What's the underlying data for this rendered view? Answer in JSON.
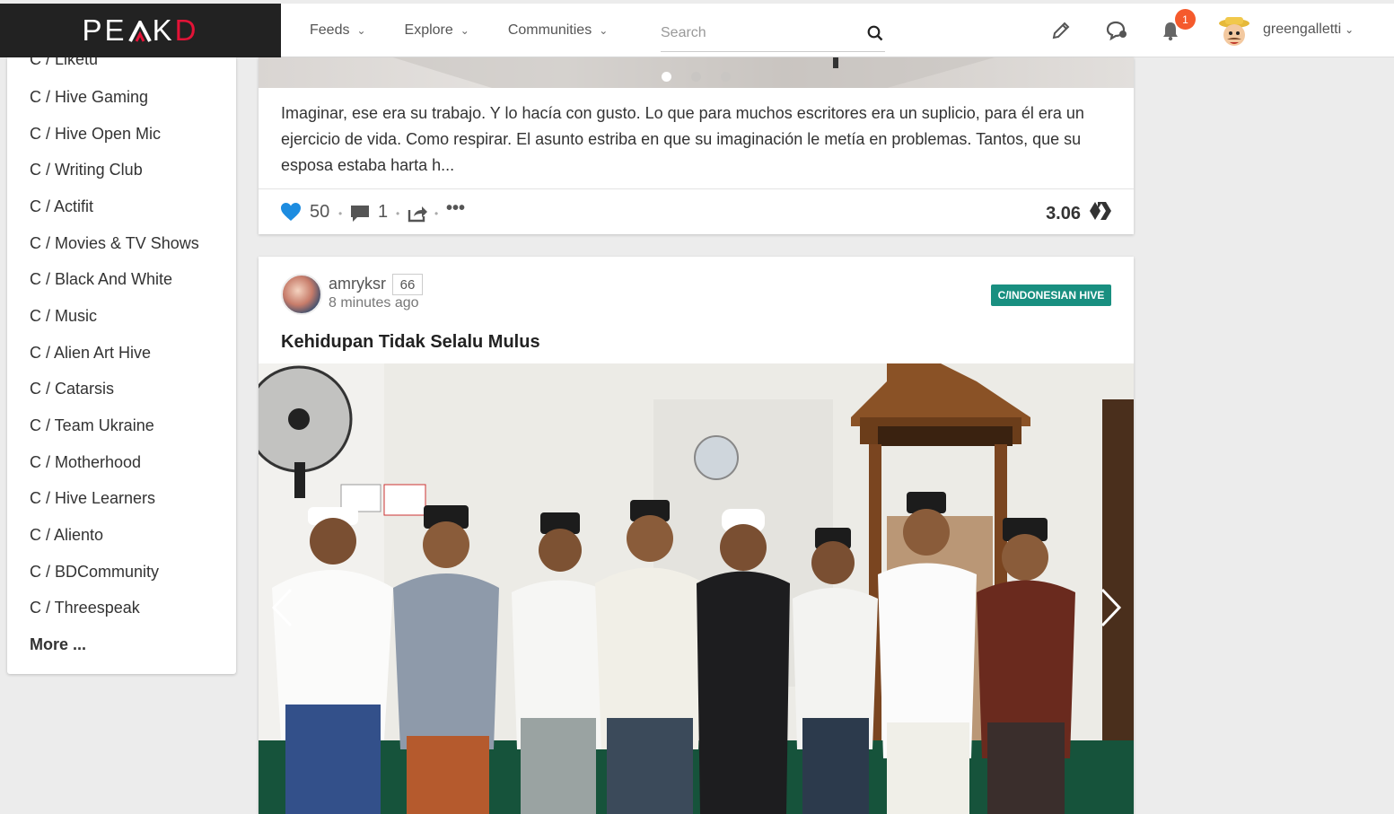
{
  "brand": {
    "logo_text_a": "PE",
    "logo_text_b": "K",
    "logo_text_c": "D"
  },
  "nav": {
    "feeds": "Feeds",
    "explore": "Explore",
    "communities": "Communities"
  },
  "search": {
    "placeholder": "Search"
  },
  "notifications": {
    "count": "1"
  },
  "user": {
    "name": "greengalletti"
  },
  "sidebar": {
    "items": [
      "C / Liketu",
      "C / Hive Gaming",
      "C / Hive Open Mic",
      "C / Writing Club",
      "C / Actifit",
      "C / Movies & TV Shows",
      "C / Black And White",
      "C / Music",
      "C / Alien Art Hive",
      "C / Catarsis",
      "C / Team Ukraine",
      "C / Motherhood",
      "C / Hive Learners",
      "C / Aliento",
      "C / BDCommunity",
      "C / Threespeak"
    ],
    "more": "More ..."
  },
  "post1": {
    "excerpt": "Imaginar, ese era su trabajo. Y lo hacía con gusto. Lo que para muchos escritores era un suplicio, para él era un ejercicio de vida. Como respirar. El asunto estriba en que su imaginación le metía en problemas. Tantos, que su esposa estaba harta h...",
    "votes": "50",
    "comments": "1",
    "payout": "3.06"
  },
  "post2": {
    "author": "amryksr",
    "reputation": "66",
    "time": "8 minutes ago",
    "community": "C/INDONESIAN HIVE",
    "title": "Kehidupan Tidak Selalu Mulus"
  },
  "colors": {
    "accent": "#e31337",
    "community_tag": "#198f80",
    "vote_heart": "#1d8ce0",
    "badge": "#f55a2c"
  }
}
